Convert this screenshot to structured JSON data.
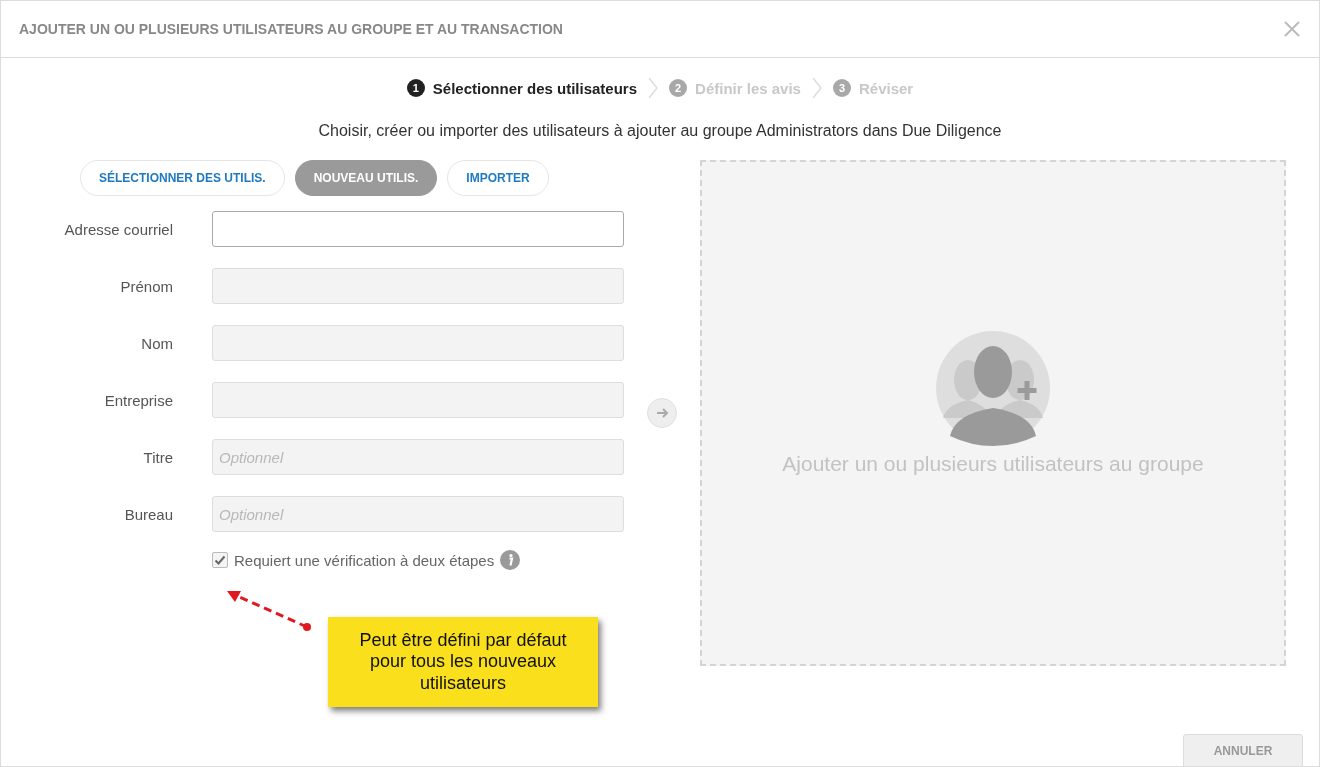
{
  "window": {
    "title": "AJOUTER UN OU PLUSIEURS UTILISATEURS AU GROUPE ET AU TRANSACTION"
  },
  "steps": [
    {
      "number": "1",
      "label": "Sélectionner des utilisateurs",
      "selected": true
    },
    {
      "number": "2",
      "label": "Définir les avis",
      "selected": false
    },
    {
      "number": "3",
      "label": "Réviser",
      "selected": false
    }
  ],
  "subtitle": "Choisir, créer ou importer des utilisateurs à ajouter au groupe Administrators dans Due Diligence",
  "mode_tabs": [
    {
      "label": "SÉLECTIONNER DES UTILIS.",
      "selected": false
    },
    {
      "label": "NOUVEAU UTILIS.",
      "selected": true
    },
    {
      "label": "IMPORTER",
      "selected": false
    }
  ],
  "fields": [
    {
      "label": "Adresse courriel",
      "disabled": false
    },
    {
      "label": "Prénom",
      "disabled": true
    },
    {
      "label": "Nom",
      "disabled": true
    },
    {
      "label": "Entreprise",
      "disabled": true
    },
    {
      "label": "Titre",
      "disabled": true,
      "placeholder": "Optionnel"
    },
    {
      "label": "Bureau",
      "disabled": true,
      "placeholder": "Optionnel"
    }
  ],
  "two_step_checkbox": {
    "label": "Requiert une vérification à deux étapes",
    "checked": true
  },
  "dropzone": {
    "text": "Ajouter un ou plusieurs utilisateurs au groupe"
  },
  "callout": {
    "text": "Peut être défini par défaut pour tous les nouveaux utilisateurs"
  },
  "cancel_button": {
    "label": "ANNULER"
  }
}
